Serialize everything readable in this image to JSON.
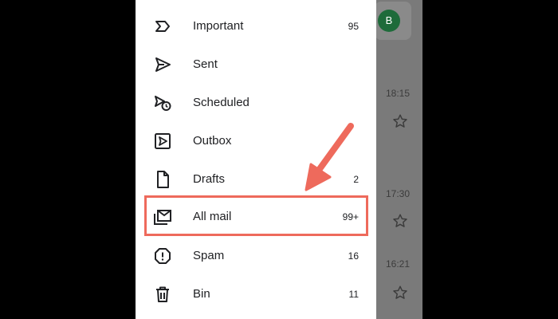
{
  "colors": {
    "drawer_bg": "#ffffff",
    "text": "#202124",
    "icon": "#202124",
    "annotation": "#ee6a5c",
    "dim_overlay": "#7a7a7a"
  },
  "drawer": {
    "items": [
      {
        "label": "Important",
        "count": "95",
        "icon": "important-icon"
      },
      {
        "label": "Sent",
        "count": "",
        "icon": "send-icon"
      },
      {
        "label": "Scheduled",
        "count": "",
        "icon": "scheduled-icon"
      },
      {
        "label": "Outbox",
        "count": "",
        "icon": "outbox-icon"
      },
      {
        "label": "Drafts",
        "count": "2",
        "icon": "draft-icon"
      },
      {
        "label": "All mail",
        "count": "99+",
        "icon": "all-mail-icon"
      },
      {
        "label": "Spam",
        "count": "16",
        "icon": "spam-icon"
      },
      {
        "label": "Bin",
        "count": "11",
        "icon": "bin-icon"
      }
    ]
  },
  "inbox": {
    "avatar_initial": "B",
    "timestamps": [
      "18:15",
      "17:30",
      "16:21"
    ]
  }
}
